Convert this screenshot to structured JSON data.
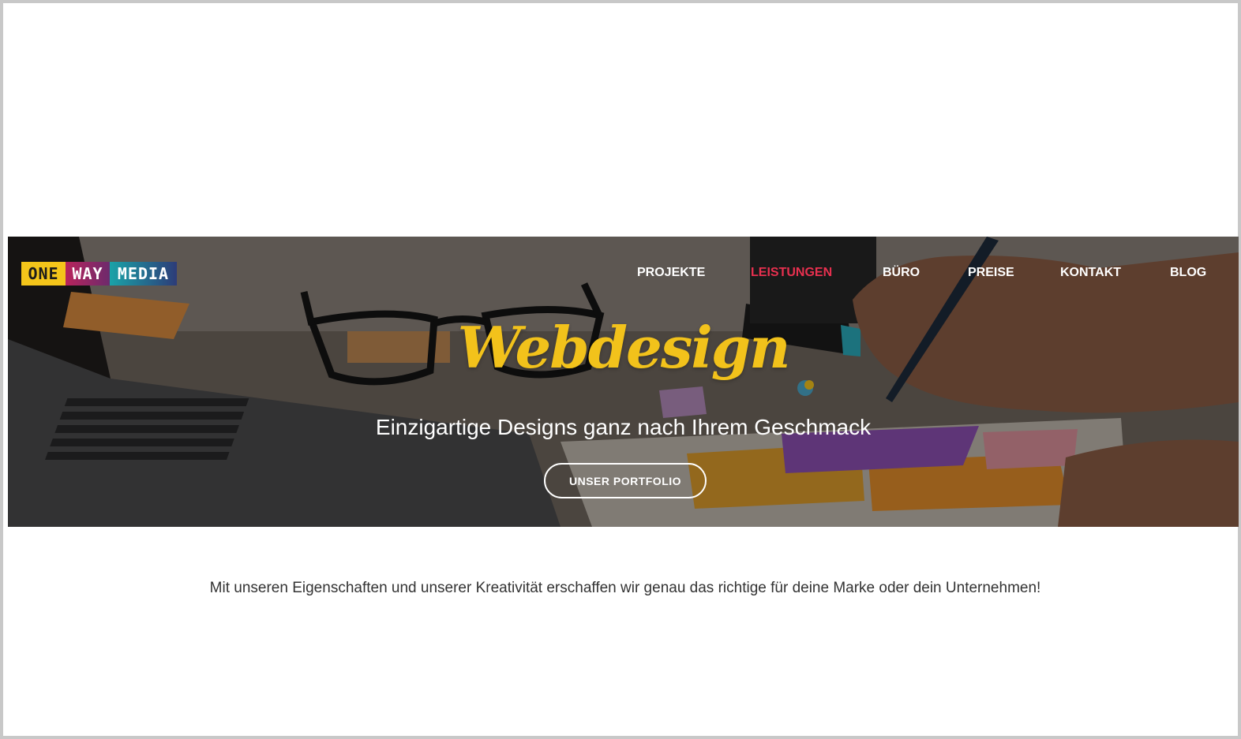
{
  "logo": {
    "part_one": "ONE",
    "part_way": "WAY",
    "part_media": "MEDIA"
  },
  "nav": {
    "items": [
      {
        "label": "PROJEKTE"
      },
      {
        "label": "LEISTUNGEN"
      },
      {
        "label": "BÜRO"
      },
      {
        "label": "PREISE"
      },
      {
        "label": "KONTAKT"
      },
      {
        "label": "BLOG"
      }
    ],
    "active": "LEISTUNGEN"
  },
  "hero": {
    "title": "Webdesign",
    "subtitle": "Einzigartige Designs ganz nach Ihrem Geschmack",
    "button_label": "UNSER PORTFOLIO"
  },
  "intro": {
    "text": "Mit unseren Eigenschaften und unserer Kreativität erschaffen wir genau das richtige für deine Marke oder dein Unternehmen!"
  },
  "colors": {
    "accent_yellow": "#f2c21b",
    "nav_active": "#e8304f",
    "text_dark": "#333333"
  }
}
